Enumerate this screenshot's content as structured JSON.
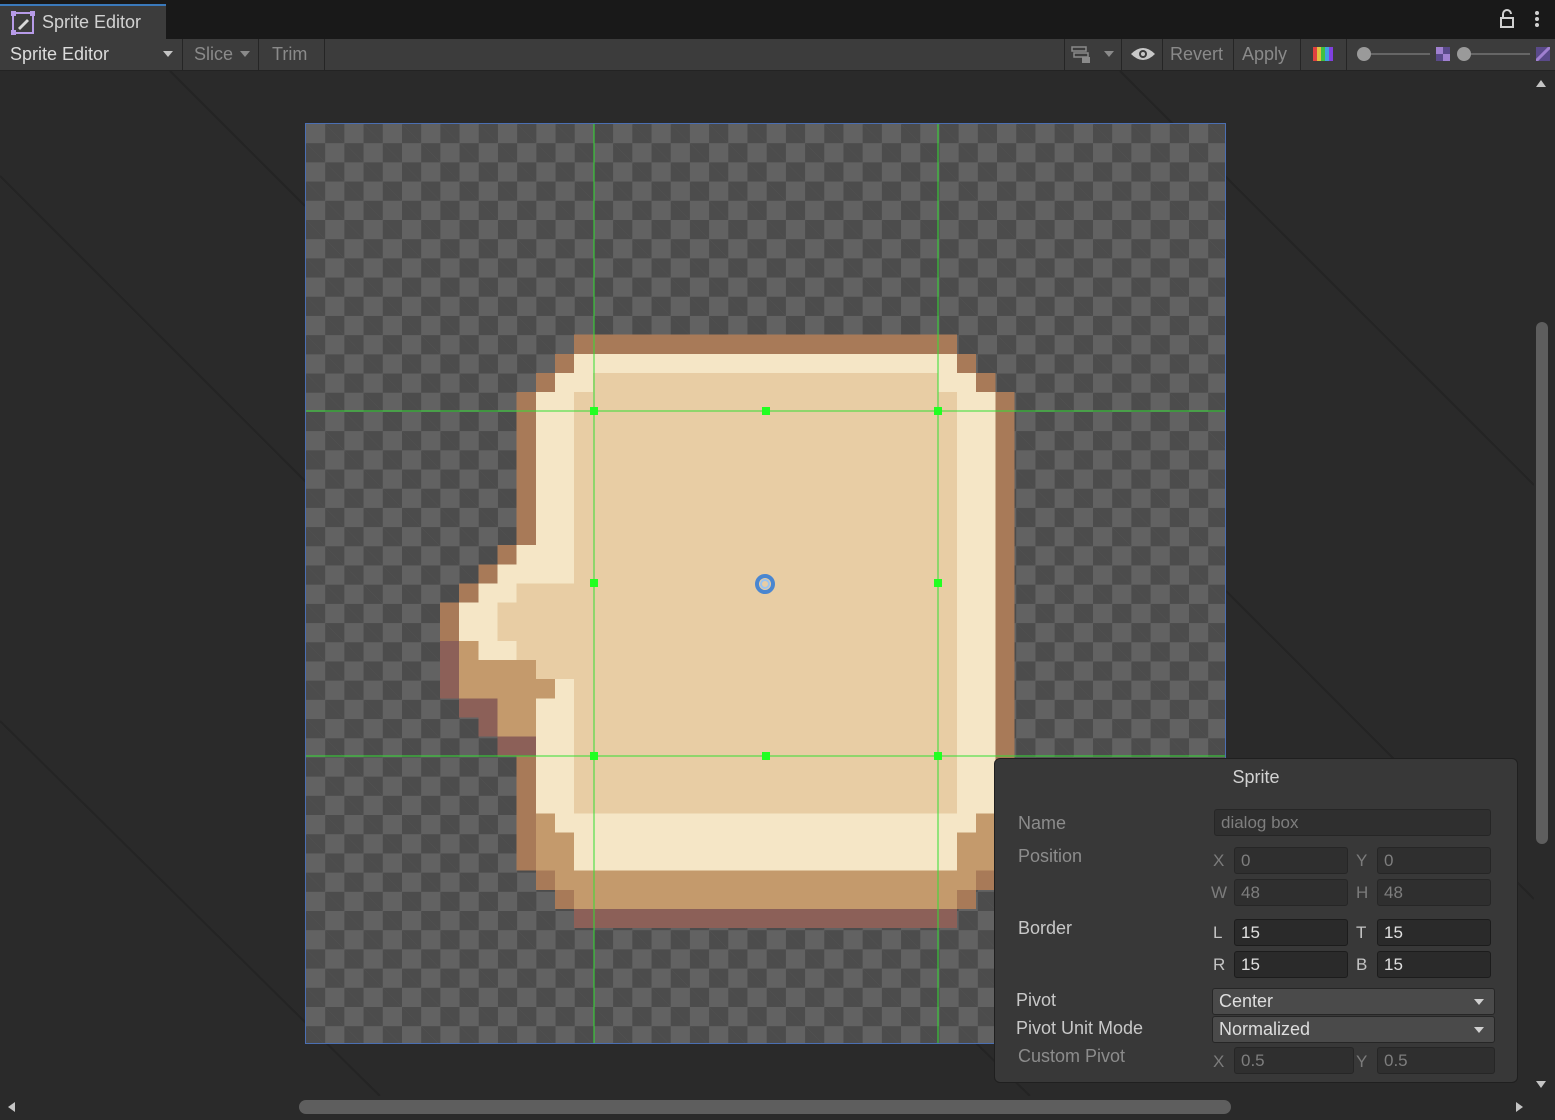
{
  "window": {
    "tab_title": "Sprite Editor"
  },
  "toolbar": {
    "mode": "Sprite Editor",
    "slice": "Slice",
    "trim": "Trim",
    "revert": "Revert",
    "apply": "Apply",
    "zoom_level": 0.0,
    "mip_level": 0.0
  },
  "sprite_panel": {
    "title": "Sprite",
    "name_label": "Name",
    "name_value": "dialog box",
    "position_label": "Position",
    "x_label": "X",
    "x_value": "0",
    "y_label": "Y",
    "y_value": "0",
    "w_label": "W",
    "w_value": "48",
    "h_label": "H",
    "h_value": "48",
    "border_label": "Border",
    "l_label": "L",
    "l_value": "15",
    "t_label": "T",
    "t_value": "15",
    "r_label": "R",
    "r_value": "15",
    "b_label": "B",
    "b_value": "15",
    "pivot_label": "Pivot",
    "pivot_value": "Center",
    "pivot_unit_label": "Pivot Unit Mode",
    "pivot_unit_value": "Normalized",
    "custom_pivot_label": "Custom Pivot",
    "cpx_label": "X",
    "cpx_value": "0.5",
    "cpy_label": "Y",
    "cpy_value": "0.5"
  },
  "colors": {
    "outline": "#a87a58",
    "outline_dark": "#8c6058",
    "highlight": "#f5e6c6",
    "fill": "#e8cda4",
    "shade": "#c49a6c",
    "border_guide": "#33dd33",
    "accent": "#3a79bb"
  }
}
